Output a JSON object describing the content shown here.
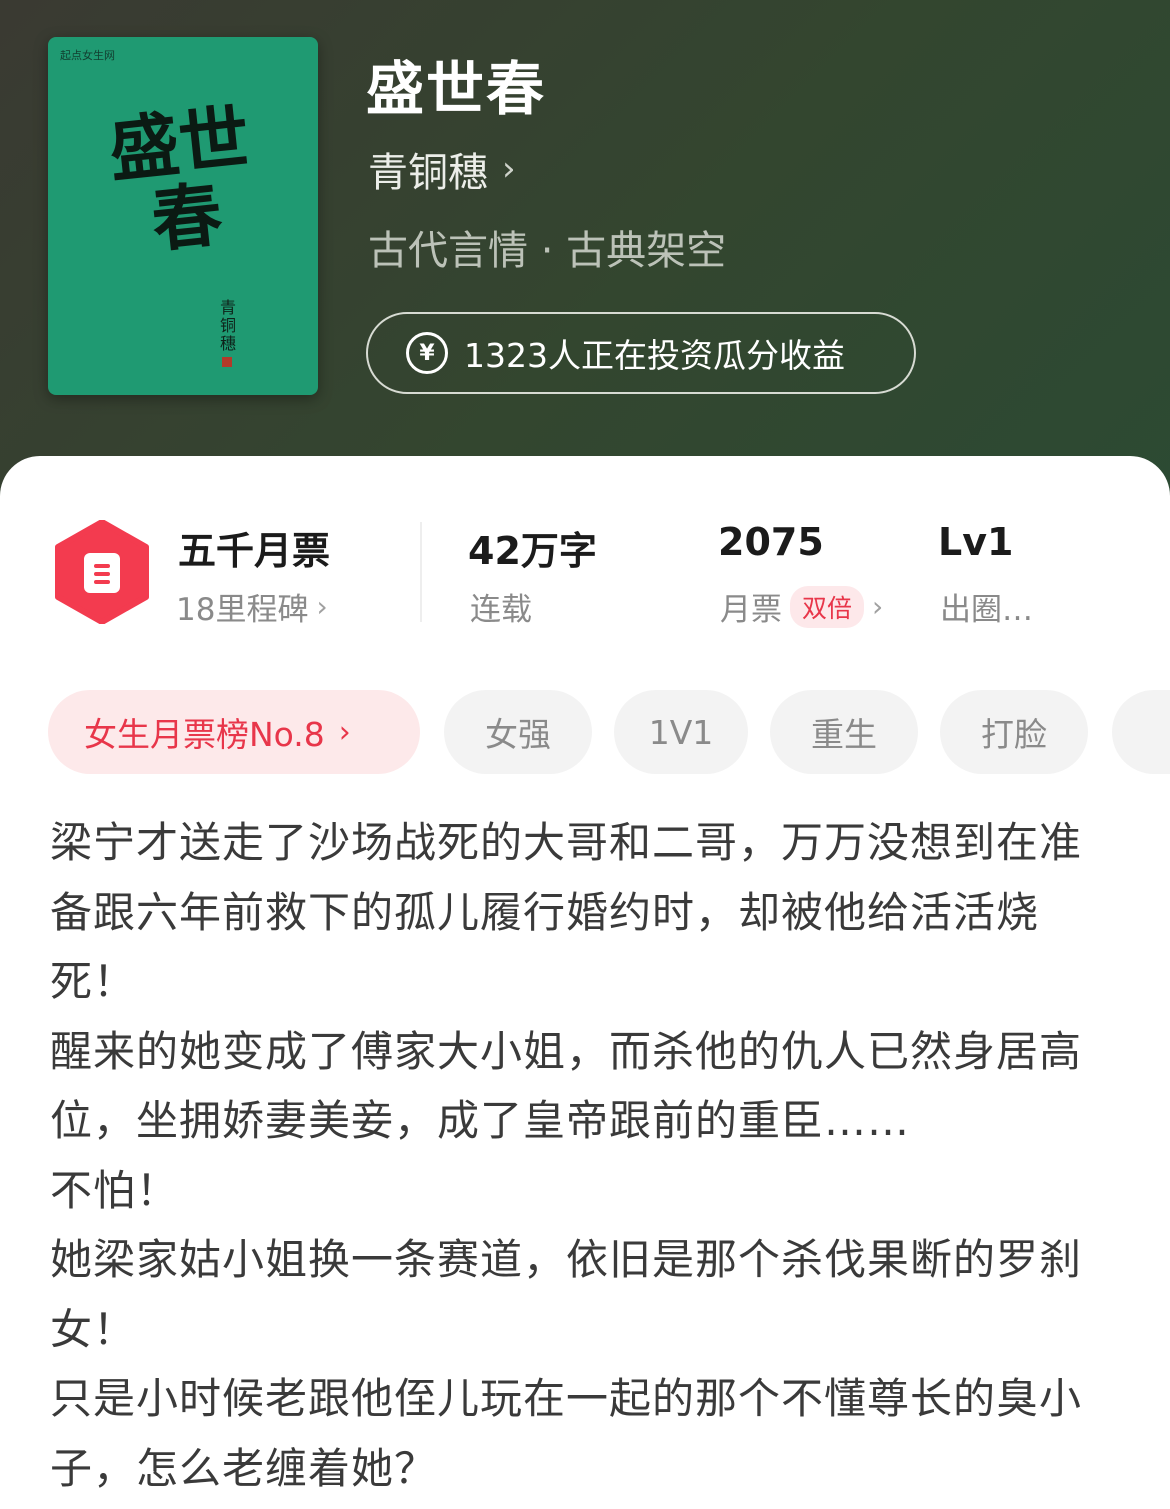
{
  "book": {
    "title": "盛世春",
    "author": "青铜穗",
    "genre": "古代言情 · 古典架空",
    "invest_text": "1323人正在投资瓜分收益",
    "cover": {
      "publisher": "起点女生网",
      "title_text": "盛世春",
      "author_text": "青铜穗"
    }
  },
  "stats": {
    "tickets_title": "五千月票",
    "milestone": "18里程碑",
    "words_title": "42万字",
    "words_sub": "连载",
    "monthly_title": "2075",
    "monthly_sub": "月票",
    "double_label": "双倍",
    "level_title": "Lv1",
    "level_sub": "出圈…"
  },
  "tags": [
    "女生月票榜No.8",
    "女强",
    "1V1",
    "重生",
    "打脸"
  ],
  "synopsis": [
    "梁宁才送走了沙场战死的大哥和二哥，万万没想到在准备跟六年前救下的孤儿履行婚约时，却被他给活活烧死！",
    "醒来的她变成了傅家大小姐，而杀他的仇人已然身居高位，坐拥娇妻美妾，成了皇帝跟前的重臣……",
    "不怕！",
    "她梁家姑小姐换一条赛道，依旧是那个杀伐果断的罗刹女！",
    "只是小时候老跟他侄儿玩在一起的那个不懂尊长的臭小子，怎么老缠着她？"
  ],
  "colors": {
    "accent_red": "#e8364a",
    "cover_green": "#1f9a72",
    "header_dark": "#33462f"
  },
  "icons": [
    "ticket-badge-icon",
    "yen-icon",
    "chevron-right-icon"
  ]
}
